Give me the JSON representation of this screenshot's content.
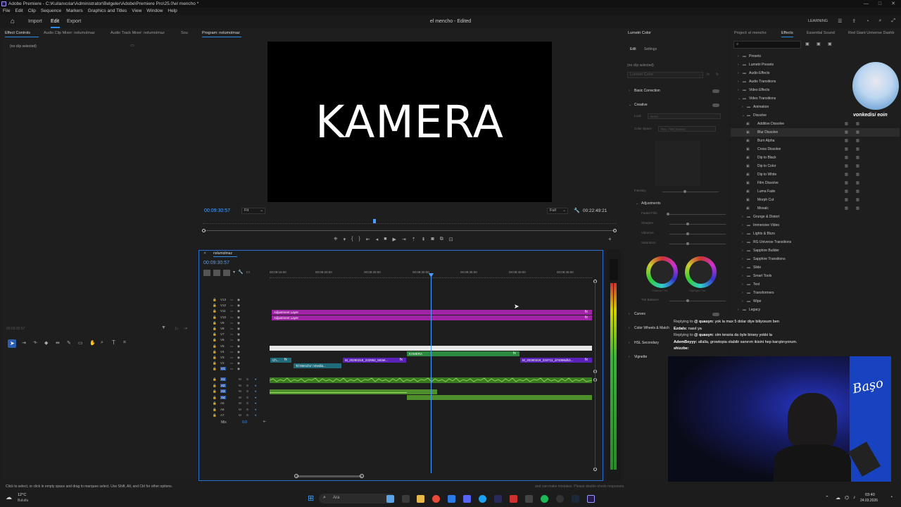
{
  "titlebar": {
    "text": "Adobe Premiere - C:\\Kullanıcılar\\Administrator\\Belgeler\\Adobe\\Premiere Pro\\25.0\\el mencho *",
    "controls": [
      "—",
      "□",
      "✕"
    ]
  },
  "menu": [
    "File",
    "Edit",
    "Clip",
    "Sequence",
    "Markers",
    "Graphics and Titles",
    "View",
    "Window",
    "Help"
  ],
  "header": {
    "tabs": [
      "Import",
      "Edit",
      "Export"
    ],
    "doc_title": "el mencho - Edited",
    "workspace_label": "LEARNING"
  },
  "left_panel": {
    "tabs": [
      "Effect Controls",
      "Audio Clip Mixer: nolumolmaz",
      "Audio Track Mixer: nolumolmaz",
      "Sou"
    ],
    "empty_text": "(no clip selected)",
    "timecode": "00:09:30:57"
  },
  "program_monitor": {
    "tab": "Program: nolumolmaz",
    "frame_text": "KAMERA",
    "timecode": "00:09:30:57",
    "fit": "Fit",
    "quality": "Full",
    "duration": "00:22:49:21"
  },
  "timeline": {
    "sequence_tab": "nolumolmaz",
    "timecode": "00:09:30:57",
    "ruler": [
      "00:09:15:00",
      "00:09:20:00",
      "00:09:25:00",
      "00:09:30:00",
      "00:09:35:00",
      "00:09:40:00",
      "00:09:45:00"
    ],
    "video_tracks": [
      "V13",
      "V12",
      "V11",
      "V10",
      "V9",
      "V8",
      "V7",
      "V6",
      "V5",
      "V4",
      "V3",
      "V2",
      "V1"
    ],
    "audio_tracks": [
      "A1",
      "A2",
      "A3",
      "A4",
      "A5",
      "A6",
      "A7"
    ],
    "mix_label": "Mix",
    "mix_value": "0.0",
    "clips": {
      "adj1": "Adjustment Layer",
      "adj2": "Adjustment Layer",
      "kamera": "KAMERA",
      "v3_a": "Ch...",
      "v3_b": "fx",
      "v3_c": "M_20260319_232952_563et...",
      "v3_d": "fx",
      "v3_e": "M_20260319_234711_d74086db3...",
      "v3_f": "fx",
      "v2_a": "'El Mencho' nmedia..."
    }
  },
  "lumetri": {
    "tab": "Lumetri Color",
    "subtabs": [
      "Edit",
      "Settings"
    ],
    "no_clip": "(no clip selected)",
    "preset_placeholder": "Lumetri Color",
    "sections": [
      "Basic Correction",
      "Creative",
      "Curves",
      "Color Wheels & Match",
      "HSL Secondary",
      "Vignette"
    ],
    "creative_look": "Look",
    "creative_look_value": "None",
    "creative_space": "Color Space",
    "creative_space_value": "Rec. 709 (Scene)",
    "intensity": "Intensity",
    "adjustments": "Adjustments",
    "adjust_rows": [
      "Faded Film",
      "Sharpen",
      "Vibrance",
      "Saturation"
    ],
    "wheel_labels": [
      "Shadow Tint",
      "Highlight Tint"
    ],
    "tint_balance": "Tint Balance"
  },
  "effects": {
    "tabs": [
      "Project: el mencho",
      "Effects",
      "Essential Sound",
      "Red Giant Universe Dashb"
    ],
    "tree": [
      {
        "label": "Presets",
        "level": 0,
        "kind": "folder"
      },
      {
        "label": "Lumetri Presets",
        "level": 0,
        "kind": "folder"
      },
      {
        "label": "Audio Effects",
        "level": 0,
        "kind": "folder"
      },
      {
        "label": "Audio Transitions",
        "level": 0,
        "kind": "folder"
      },
      {
        "label": "Video Effects",
        "level": 0,
        "kind": "folder"
      },
      {
        "label": "Video Transitions",
        "level": 0,
        "kind": "folder-open"
      },
      {
        "label": "Animation",
        "level": 1,
        "kind": "folder"
      },
      {
        "label": "Dissolve",
        "level": 1,
        "kind": "folder-open"
      },
      {
        "label": "Additive Dissolve",
        "level": 2,
        "kind": "item"
      },
      {
        "label": "Blur Dissolve",
        "level": 2,
        "kind": "item"
      },
      {
        "label": "Burn Alpha",
        "level": 2,
        "kind": "item"
      },
      {
        "label": "Cross Dissolve",
        "level": 2,
        "kind": "item"
      },
      {
        "label": "Dip to Black",
        "level": 2,
        "kind": "item"
      },
      {
        "label": "Dip to Color",
        "level": 2,
        "kind": "item"
      },
      {
        "label": "Dip to White",
        "level": 2,
        "kind": "item"
      },
      {
        "label": "Film Dissolve",
        "level": 2,
        "kind": "item"
      },
      {
        "label": "Luma Fade",
        "level": 2,
        "kind": "item"
      },
      {
        "label": "Morph Cut",
        "level": 2,
        "kind": "item"
      },
      {
        "label": "Mosaic",
        "level": 2,
        "kind": "item"
      },
      {
        "label": "Grunge & Distort",
        "level": 1,
        "kind": "folder"
      },
      {
        "label": "Immersive Video",
        "level": 1,
        "kind": "folder"
      },
      {
        "label": "Lights & Blurs",
        "level": 1,
        "kind": "folder"
      },
      {
        "label": "RG Universe Transitions",
        "level": 1,
        "kind": "folder"
      },
      {
        "label": "Sapphire Builder",
        "level": 1,
        "kind": "folder"
      },
      {
        "label": "Sapphire Transitions",
        "level": 1,
        "kind": "folder"
      },
      {
        "label": "Slide",
        "level": 1,
        "kind": "folder"
      },
      {
        "label": "Smart Tools",
        "level": 1,
        "kind": "folder"
      },
      {
        "label": "Text",
        "level": 1,
        "kind": "folder"
      },
      {
        "label": "Transformers",
        "level": 1,
        "kind": "folder"
      },
      {
        "label": "Wipe",
        "level": 1,
        "kind": "folder"
      },
      {
        "label": "Legacy",
        "level": 0,
        "kind": "folder"
      }
    ]
  },
  "overlay": {
    "streamer_tag": "vonkedisi eoin",
    "webcam_label": "Başo",
    "chat": [
      {
        "prefix": "Replying to",
        "user": "@ quasyn:",
        "text": "yok la max 5 dolar diye biliyosum ben"
      },
      {
        "prefix": "",
        "user": "Ezdals:",
        "text": "nasıl ya"
      },
      {
        "prefix": "Replying to",
        "user": "@ quasyn:",
        "text": "olm teraria da öyle birsey yokki la"
      },
      {
        "prefix": "",
        "user": "AdemBeyyy:",
        "text": "allalla, growtopia olabilir sanırım ikisini hep karıştırıyorum."
      },
      {
        "prefix": "",
        "user": "shizzbe:",
        "text": ""
      }
    ]
  },
  "statusbar": {
    "text": "Click to select, or click in empty space and drag to marquee select. Use Shift, Alt, and Ctrl for other options.",
    "hint": "and can make mistakes. Please double-check responses."
  },
  "taskbar": {
    "weather_temp": "12°C",
    "weather_desc": "Bulutlu",
    "search_placeholder": "Ara",
    "clock_time": "03:40",
    "clock_date": "24.03.2026"
  },
  "colors": {
    "accent": "#2d8ceb",
    "adjustment_clip": "#a124a6",
    "video_clip_green": "#2b8a3e",
    "audio_green": "#4d8f2a",
    "purple_clip": "#5a22b8",
    "teal_clip": "#1f6b7a"
  }
}
